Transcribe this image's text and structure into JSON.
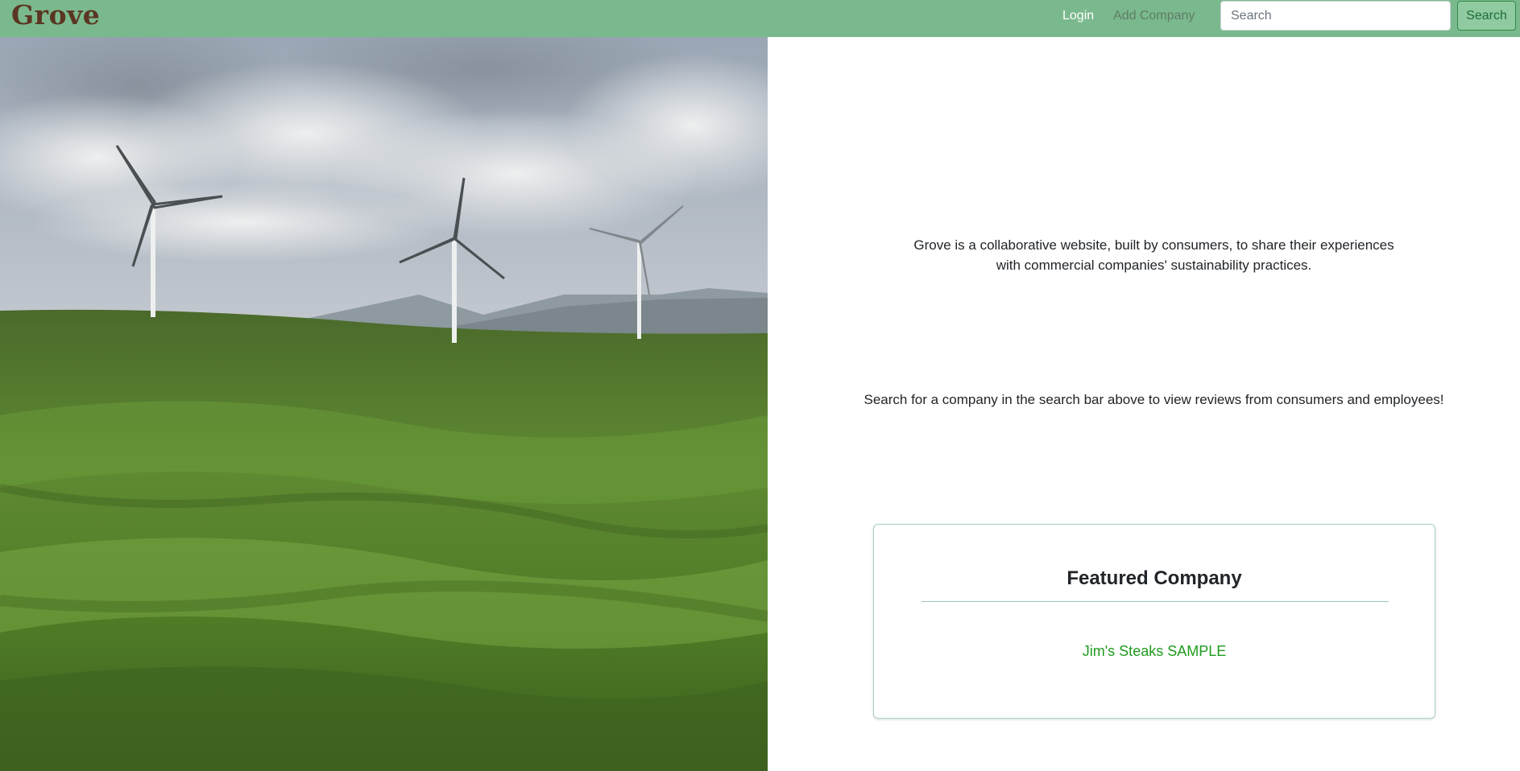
{
  "navbar": {
    "brand": "Grove",
    "login_label": "Login",
    "add_company_label": "Add Company",
    "search_placeholder": "Search",
    "search_button_label": "Search",
    "background_color": "#7ab98d",
    "brand_color": "#5a3622"
  },
  "hero": {
    "image_alt": "wind-turbines-on-green-hills-photo"
  },
  "main": {
    "intro_text": "Grove is a collaborative website, built by consumers, to share their experiences with commercial companies' sustainability practices.",
    "instruction_text": "Search for a company in the search bar above to view reviews from consumers and employees!"
  },
  "featured": {
    "title": "Featured Company",
    "company_name": "Jim's Steaks SAMPLE",
    "link_color": "#1e9c1e"
  }
}
